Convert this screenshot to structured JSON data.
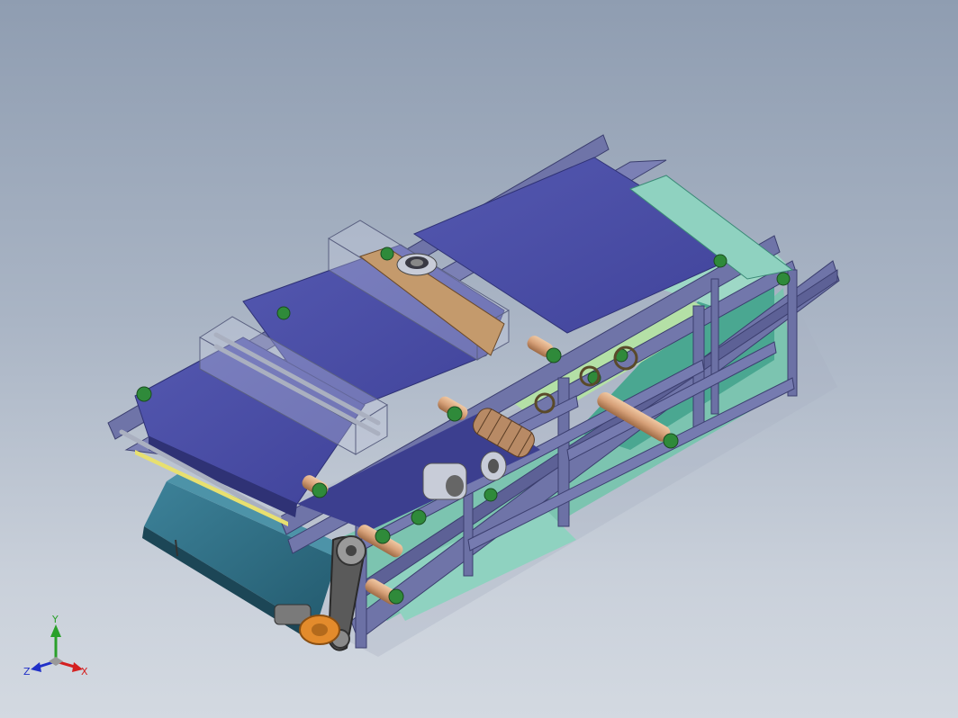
{
  "viewport": {
    "background_top": "#8f9db1",
    "background_bottom": "#d3d9e1"
  },
  "model": {
    "part": "belt-filter-press-assembly",
    "colors": {
      "frame": "#6f74a8",
      "frame_dark": "#4e5284",
      "belt": "#4b4fa3",
      "belt_dark": "#3a3d86",
      "teal": "#7fc7b4",
      "tank": "#2f6f86",
      "roller": "#d9a77e",
      "bearing": "#2f8a3a",
      "drive": "#e38b2c",
      "chain": "#3b3b3b"
    }
  },
  "triad": {
    "x_label": "X",
    "y_label": "Y",
    "z_label": "Z",
    "x_color": "#d42020",
    "y_color": "#2aa02a",
    "z_color": "#2030c8"
  }
}
